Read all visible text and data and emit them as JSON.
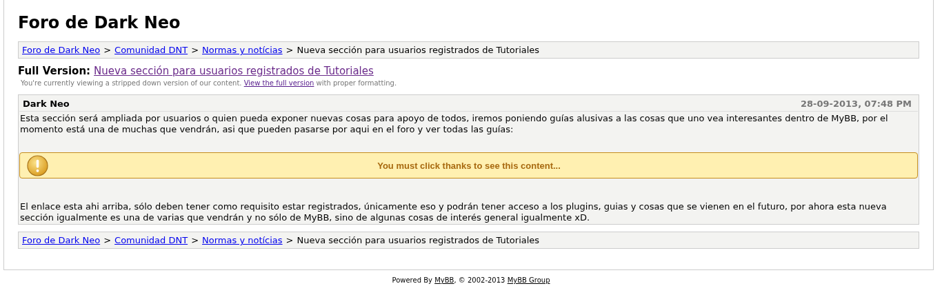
{
  "site_title": "Foro de Dark Neo",
  "breadcrumb_top": [
    {
      "text": "Foro de Dark Neo",
      "kind": "link"
    },
    {
      "text": ">",
      "kind": "separator"
    },
    {
      "text": "Comunidad DNT",
      "kind": "link"
    },
    {
      "text": ">",
      "kind": "separator"
    },
    {
      "text": "Normas y notícias",
      "kind": "link"
    },
    {
      "text": ">",
      "kind": "separator"
    },
    {
      "text": "Nueva sección para usuarios registrados de Tutoriales",
      "kind": "current"
    }
  ],
  "full_version": {
    "label": "Full Version:",
    "link": "Nueva sección para usuarios registrados de Tutoriales"
  },
  "notice": {
    "before": "You're currently viewing a stripped down version of our content.",
    "link": "View the full version",
    "after": "with proper formatting."
  },
  "post": {
    "author": "Dark Neo",
    "date": "28-09-2013, 07:48 PM",
    "body": [
      {
        "kind": "text",
        "text": "Esta sección será ampliada por usuarios o quien pueda exponer nuevas cosas para apoyo de todos, iremos poniendo guías alusivas a las cosas que uno vea interesantes dentro de MyBB, por el momento está una de muchas que vendrán, asi que pueden pasarse por aqui en el foro y ver todas las guías:"
      },
      {
        "kind": "hidden",
        "text": "You must click thanks to see this content..."
      },
      {
        "kind": "text",
        "text": "El enlace esta ahi arriba, sólo deben tener como requisito estar registrados, únicamente eso y podrán tener acceso a los plugins, guias y cosas que se vienen en el futuro, por ahora esta nueva sección igualmente es una de varias que vendrán y no sólo de MyBB, sino de algunas cosas de interés general igualmente xD."
      }
    ]
  },
  "breadcrumb_bottom": [
    {
      "text": "Foro de Dark Neo",
      "kind": "link"
    },
    {
      "text": ">",
      "kind": "separator"
    },
    {
      "text": "Comunidad DNT",
      "kind": "link"
    },
    {
      "text": ">",
      "kind": "separator"
    },
    {
      "text": "Normas y notícias",
      "kind": "link"
    },
    {
      "text": ">",
      "kind": "separator"
    },
    {
      "text": "Nueva sección para usuarios registrados de Tutoriales",
      "kind": "current"
    }
  ],
  "footer": {
    "before": "Powered By",
    "link1": "MyBB",
    "middle": ", © 2002-2013",
    "link2": "MyBB Group"
  }
}
